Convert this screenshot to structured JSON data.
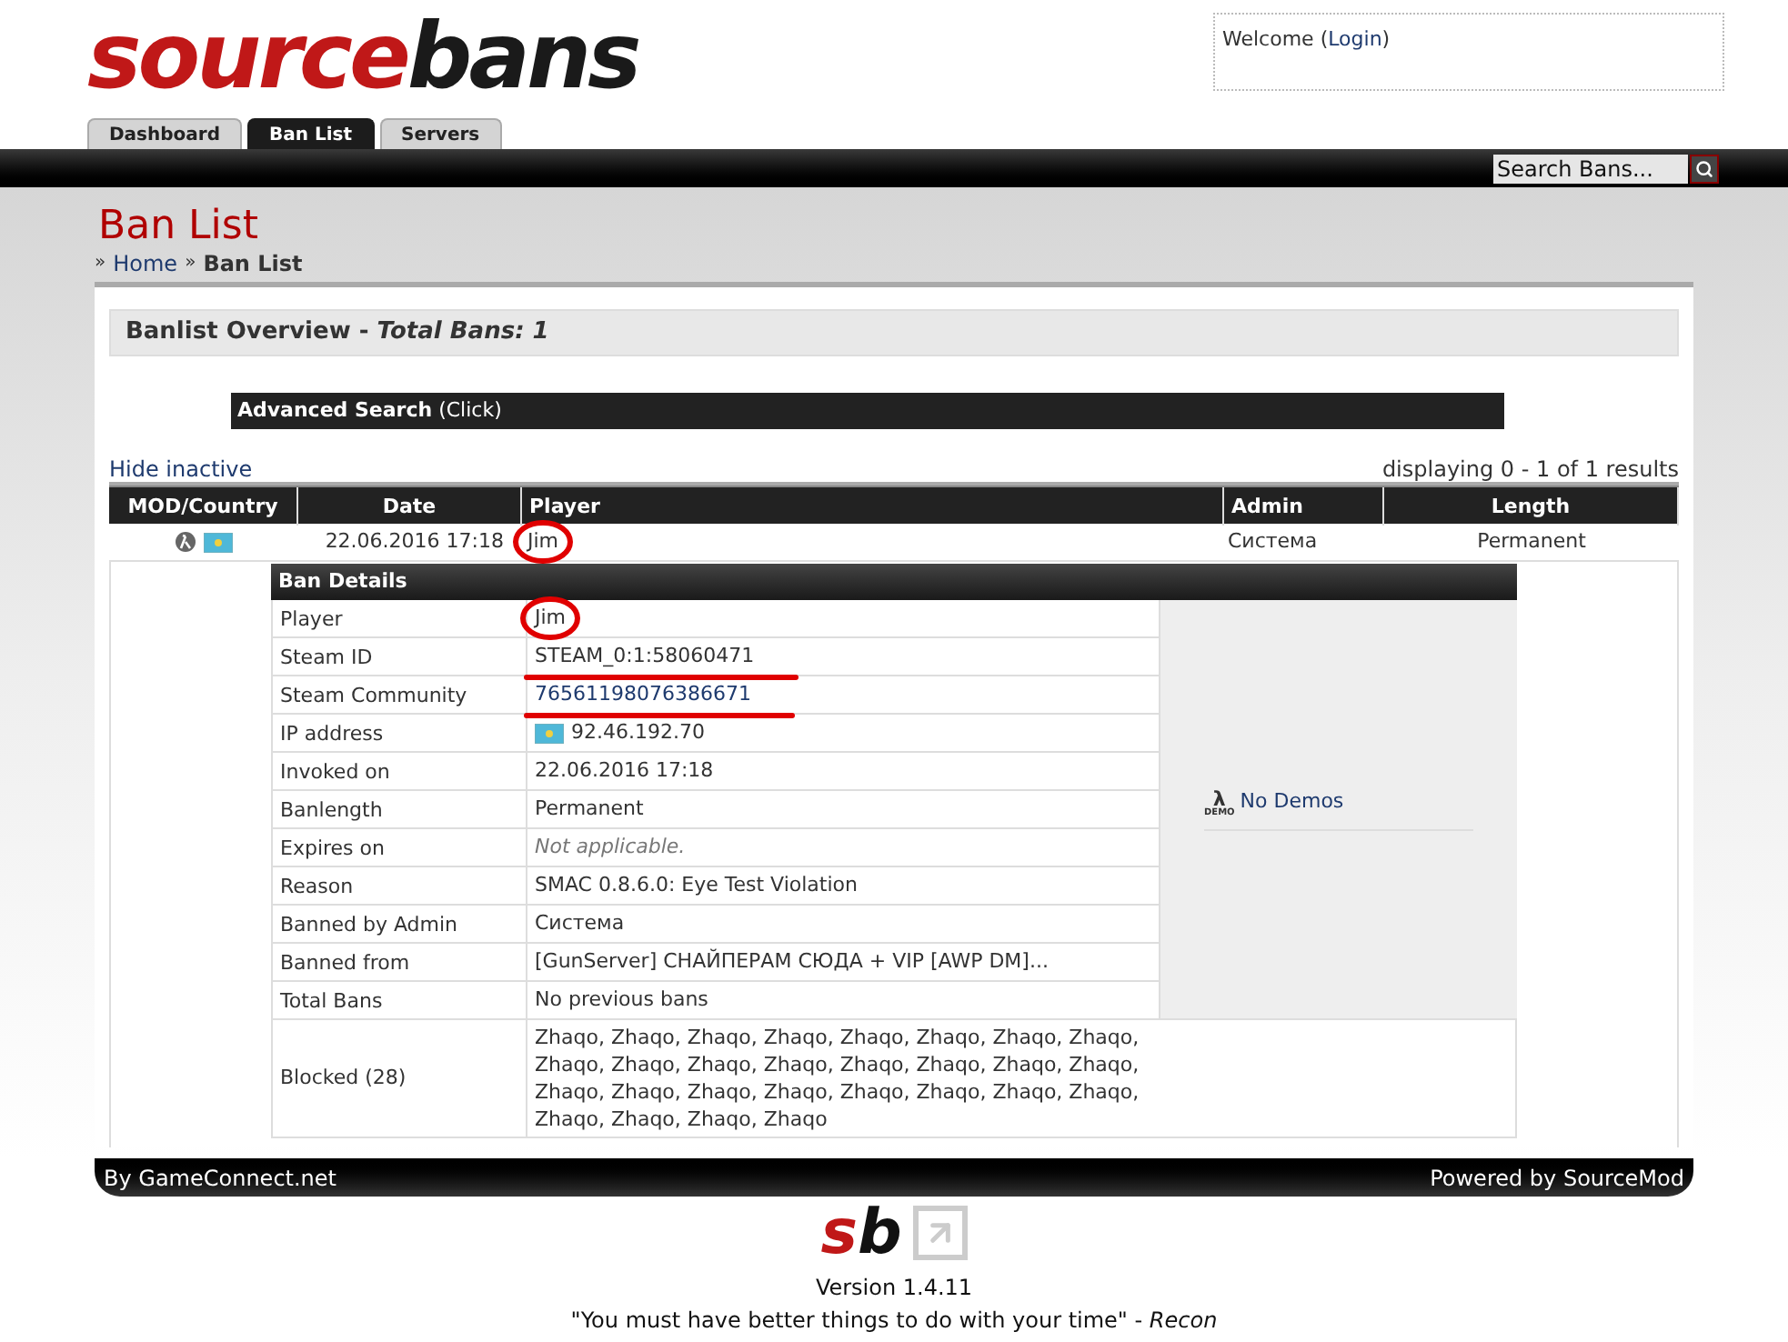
{
  "logo": {
    "part_1": "source",
    "part_2": "bans"
  },
  "welcome": {
    "prefix": "Welcome (",
    "link": "Login",
    "suffix": ")"
  },
  "tabs": [
    {
      "label": "Dashboard",
      "selected": false
    },
    {
      "label": "Ban List",
      "selected": true
    },
    {
      "label": "Servers",
      "selected": false
    }
  ],
  "search": {
    "placeholder": "Search Bans..."
  },
  "page_title": "Ban List",
  "breadcrumb": [
    {
      "separator": "»",
      "label": "Home",
      "kind": "link"
    },
    {
      "separator": "»",
      "label": "Ban List",
      "kind": "current"
    }
  ],
  "overview": {
    "title": "Banlist Overview - ",
    "total": "Total Bans: 1"
  },
  "advanced_search": {
    "title": "Advanced Search",
    "hint": "(Click)"
  },
  "hide_inactive": "Hide inactive",
  "results": "displaying 0 - 1 of 1 results",
  "table": {
    "columns": [
      "MOD/Country",
      "Date",
      "Player",
      "Admin",
      "Length"
    ],
    "rows": [
      {
        "date": "22.06.2016 17:18",
        "player": "Jim",
        "circled": true,
        "admin": "Система",
        "length": "Permanent"
      }
    ]
  },
  "ban_details": {
    "title": "Ban Details",
    "rows": [
      {
        "label": "Player",
        "value": "Jim",
        "kind": "text",
        "circled": true
      },
      {
        "label": "Steam ID",
        "value": "STEAM_0:1:58060471",
        "kind": "text",
        "underlined": true
      },
      {
        "label": "Steam Community",
        "value": "76561198076386671",
        "kind": "link",
        "underlined": true
      },
      {
        "label": "IP address",
        "value": "92.46.192.70",
        "kind": "flag"
      },
      {
        "label": "Invoked on",
        "value": "22.06.2016 17:18",
        "kind": "text"
      },
      {
        "label": "Banlength",
        "value": "Permanent",
        "kind": "text"
      },
      {
        "label": "Expires on",
        "value": "Not applicable.",
        "kind": "italic"
      },
      {
        "label": "Reason",
        "value": "SMAC 0.8.6.0: Eye Test Violation",
        "kind": "text"
      },
      {
        "label": "Banned by Admin",
        "value": "Система",
        "kind": "text"
      },
      {
        "label": "Banned from",
        "value": "[GunServer] СНАЙПЕРАМ СЮДА + VIP [AWP DM]...",
        "kind": "text"
      },
      {
        "label": "Total Bans",
        "value": "No previous bans",
        "kind": "text"
      }
    ],
    "blocked": {
      "label": "Blocked (28)",
      "lines": [
        "Zhaqo, Zhaqo, Zhaqo, Zhaqo, Zhaqo, Zhaqo, Zhaqo, Zhaqo,",
        "Zhaqo, Zhaqo, Zhaqo, Zhaqo, Zhaqo, Zhaqo, Zhaqo, Zhaqo,",
        "Zhaqo, Zhaqo, Zhaqo, Zhaqo, Zhaqo, Zhaqo, Zhaqo, Zhaqo,",
        "Zhaqo, Zhaqo, Zhaqo, Zhaqo"
      ]
    },
    "demo_icon_symbol": "λ",
    "demo_icon_label": "DEMO",
    "demos": "No Demos"
  },
  "footer": {
    "left": "By GameConnect.net",
    "right": "Powered by SourceMod",
    "logo_1": "s",
    "logo_2": "b",
    "version": "Version 1.4.11",
    "quote": "\"You must have better things to do with your time\" - ",
    "quote_author": "Recon"
  }
}
